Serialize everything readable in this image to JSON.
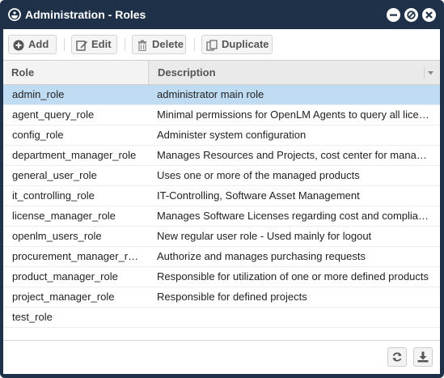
{
  "window": {
    "title": "Administration - Roles"
  },
  "toolbar": {
    "add_label": "Add",
    "edit_label": "Edit",
    "delete_label": "Delete",
    "duplicate_label": "Duplicate"
  },
  "grid": {
    "columns": [
      "Role",
      "Description"
    ],
    "selected_index": 0,
    "rows": [
      {
        "role": "admin_role",
        "description": "administrator main role"
      },
      {
        "role": "agent_query_role",
        "description": "Minimal permissions for OpenLM Agents to query all lice…"
      },
      {
        "role": "config_role",
        "description": "Administer system configuration"
      },
      {
        "role": "department_manager_role",
        "description": "Manages Resources and Projects, cost center for mana…"
      },
      {
        "role": "general_user_role",
        "description": "Uses one or more of the managed products"
      },
      {
        "role": "it_controlling_role",
        "description": "IT-Controlling, Software Asset Management"
      },
      {
        "role": "license_manager_role",
        "description": "Manages Software Licenses regarding cost and complia…"
      },
      {
        "role": "openlm_users_role",
        "description": "New regular user role - Used mainly for logout"
      },
      {
        "role": "procurement_manager_r…",
        "description": "Authorize and manages purchasing requests"
      },
      {
        "role": "product_manager_role",
        "description": "Responsible for utilization of one or more defined products"
      },
      {
        "role": "project_manager_role",
        "description": "Responsible for defined projects"
      },
      {
        "role": "test_role",
        "description": ""
      }
    ]
  },
  "icons": {
    "title": "openlm-logo-icon",
    "add": "plus-circle-icon",
    "edit": "edit-icon",
    "delete": "trash-icon",
    "duplicate": "copy-icon",
    "minimize": "minimize-icon",
    "maximize": "restore-icon",
    "close": "close-icon",
    "refresh": "refresh-icon",
    "export": "download-icon"
  },
  "colors": {
    "titlebar": "#1f3148",
    "selected_row": "#c0dcf3",
    "header_bg": "#f3f3f3"
  }
}
